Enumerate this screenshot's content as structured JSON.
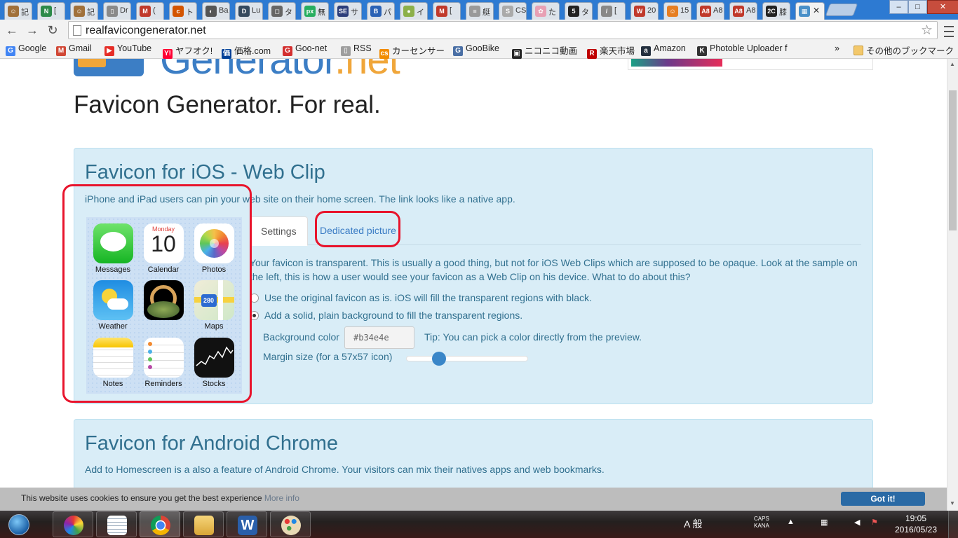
{
  "browser": {
    "tabs": [
      {
        "label": "記",
        "color": "#a0703a",
        "glyph": "☺"
      },
      {
        "label": "[",
        "color": "#2c8a4a",
        "glyph": "N"
      },
      {
        "label": "記",
        "color": "#a0703a",
        "glyph": "☺"
      },
      {
        "label": "Dr",
        "color": "#8a8a8a",
        "glyph": "▯"
      },
      {
        "label": "(",
        "color": "#c0392b",
        "glyph": "M"
      },
      {
        "label": "ト",
        "color": "#d35400",
        "glyph": "c"
      },
      {
        "label": "Ba",
        "color": "#555555",
        "glyph": "◐"
      },
      {
        "label": "Lu",
        "color": "#34495e",
        "glyph": "D"
      },
      {
        "label": "タ",
        "color": "#666666",
        "glyph": "◻"
      },
      {
        "label": "無",
        "color": "#27ae60",
        "glyph": "px"
      },
      {
        "label": "サ",
        "color": "#2c3e7a",
        "glyph": "SE"
      },
      {
        "label": "パ",
        "color": "#2a62b5",
        "glyph": "B"
      },
      {
        "label": "イ",
        "color": "#8cb04a",
        "glyph": "●"
      },
      {
        "label": "[",
        "color": "#c0392b",
        "glyph": "M"
      },
      {
        "label": "艇",
        "color": "#999999",
        "glyph": "≡"
      },
      {
        "label": "CS",
        "color": "#aaaaaa",
        "glyph": "S"
      },
      {
        "label": "た",
        "color": "#e8a0b4",
        "glyph": "✿"
      },
      {
        "label": "タ",
        "color": "#222222",
        "glyph": "5"
      },
      {
        "label": "[",
        "color": "#888888",
        "glyph": "/"
      },
      {
        "label": "20",
        "color": "#c0392b",
        "glyph": "W"
      },
      {
        "label": "15",
        "color": "#e67e22",
        "glyph": "☺"
      },
      {
        "label": "A8",
        "color": "#c0392b",
        "glyph": "A8"
      },
      {
        "label": "A8",
        "color": "#c0392b",
        "glyph": "A8"
      },
      {
        "label": "膝",
        "color": "#222222",
        "glyph": "2C"
      }
    ],
    "active_tab_glyph": "▦",
    "active_tab_close": "✕",
    "window_buttons": {
      "minimize": "–",
      "maximize": "□",
      "close": "✕"
    },
    "url": "realfavicongenerator.net",
    "nav": {
      "back": "←",
      "forward": "→",
      "reload": "↻",
      "star": "☆"
    },
    "bookmarks": [
      {
        "label": "Google",
        "icon": "G",
        "color": "#4285f4"
      },
      {
        "label": "Gmail",
        "icon": "M",
        "color": "#d14836"
      },
      {
        "label": "YouTube",
        "icon": "▶",
        "color": "#e52d27"
      },
      {
        "label": "ヤフオク!",
        "icon": "Y!",
        "color": "#ff0033"
      },
      {
        "label": "価格.com",
        "icon": "価",
        "color": "#004098"
      },
      {
        "label": "Goo-net",
        "icon": "G",
        "color": "#d32f2f"
      },
      {
        "label": "RSS",
        "icon": "▯",
        "color": "#9e9e9e"
      },
      {
        "label": "カーセンサー",
        "icon": "cs",
        "color": "#f28c00"
      },
      {
        "label": "GooBike",
        "icon": "G",
        "color": "#4a6fa5"
      },
      {
        "label": "ニコニコ動画",
        "icon": "▣",
        "color": "#252525"
      },
      {
        "label": "楽天市場",
        "icon": "R",
        "color": "#bf0000"
      },
      {
        "label": "Amazon",
        "icon": "a",
        "color": "#232f3e"
      },
      {
        "label": "Photoble Uploader f",
        "icon": "K",
        "color": "#333333"
      }
    ],
    "bookmarks_overflow": "»",
    "other_bookmarks": "その他のブックマーク"
  },
  "page": {
    "logo_text": "Generator",
    "logo_tld": ".net",
    "hero": "Favicon Generator. For real.",
    "ios_section": {
      "title": "Favicon for iOS - Web Clip",
      "desc": "iPhone and iPad users can pin your web site on their home screen. The link looks like a native app.",
      "apps": [
        {
          "label": "Messages"
        },
        {
          "label": "Calendar"
        },
        {
          "label": "Photos"
        },
        {
          "label": "Weather"
        },
        {
          "label": ""
        },
        {
          "label": "Maps"
        },
        {
          "label": "Notes"
        },
        {
          "label": "Reminders"
        },
        {
          "label": "Stocks"
        }
      ],
      "calendar_day": "Monday",
      "calendar_date": "10",
      "maps_shield": "280",
      "tabs": {
        "settings": "Settings",
        "dedicated": "Dedicated picture"
      },
      "transparency_note": "Your favicon is transparent. This is usually a good thing, but not for iOS Web Clips which are supposed to be opaque. Look at the sample on the left, this is how a user would see your favicon as a Web Clip on his device. What to do about this?",
      "option_original": "Use the original favicon as is. iOS will fill the transparent regions with black.",
      "option_solid": "Add a solid, plain background to fill the transparent regions.",
      "bg_color_label": "Background color",
      "bg_color_value": "#b34e4e",
      "bg_tip": "Tip: You can pick a color directly from the preview.",
      "margin_label": "Margin size (for a 57x57 icon)",
      "margin_fraction": 0.27
    },
    "android_section": {
      "title": "Favicon for Android Chrome",
      "desc": "Add to Homescreen is a also a feature of Android Chrome. Your visitors can mix their natives apps and web bookmarks."
    },
    "cookie": {
      "message": "This website uses cookies to ensure you get the best experience",
      "more": "More info",
      "button": "Got it!"
    },
    "annotation_color": "#e8142c"
  },
  "taskbar": {
    "ime": "A 般",
    "caps": "CAPS",
    "kana": "KANA",
    "time": "19:05",
    "date": "2016/05/23"
  }
}
